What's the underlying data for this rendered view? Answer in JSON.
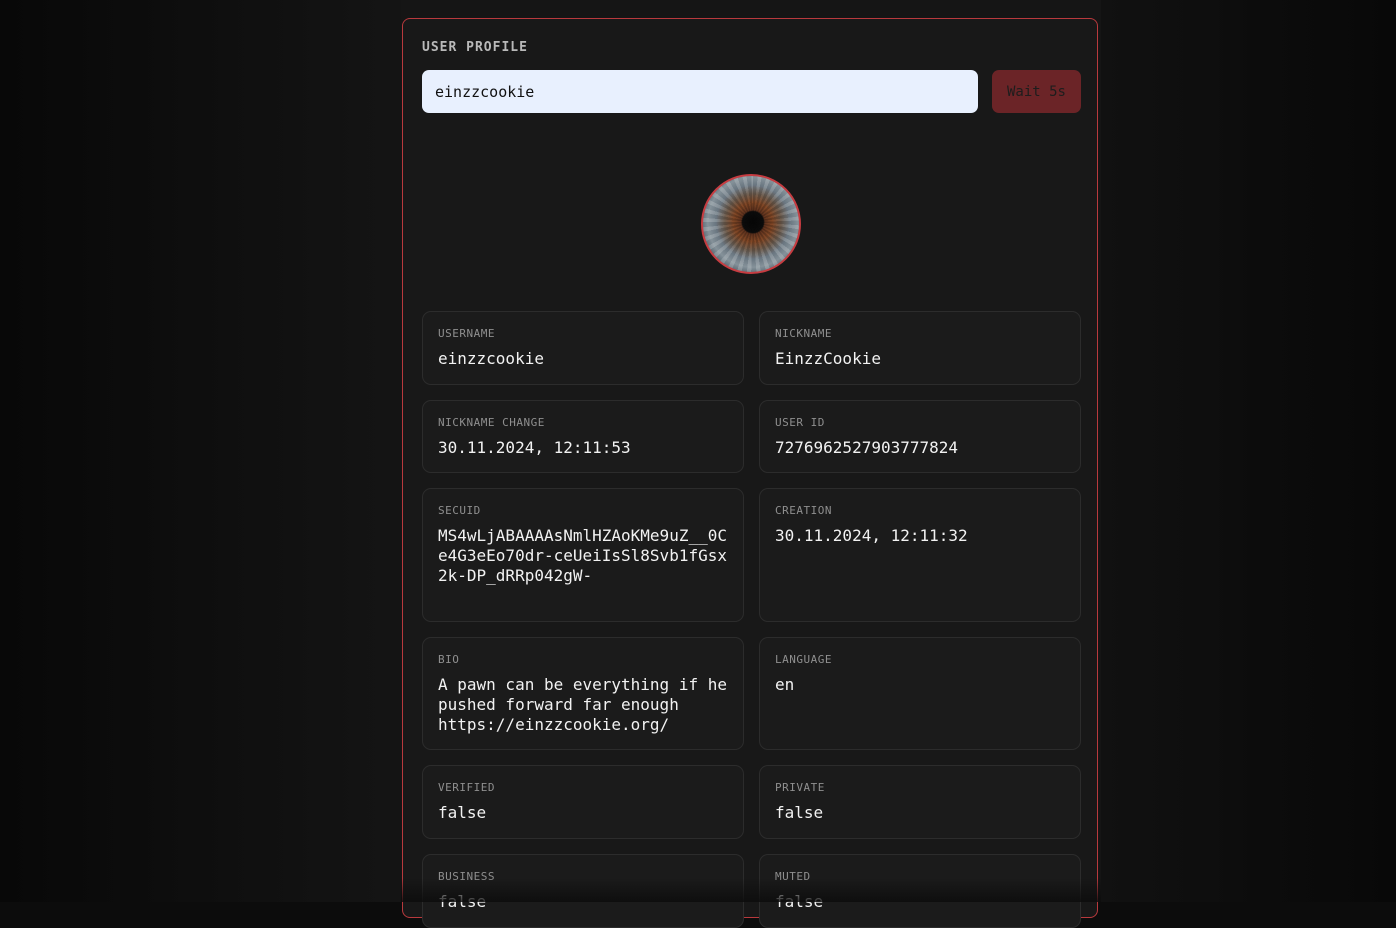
{
  "profile": {
    "section_title": "USER PROFILE",
    "search_value": "einzzcookie",
    "wait_label": "Wait 5s",
    "fields": {
      "username": {
        "label": "USERNAME",
        "value": "einzzcookie"
      },
      "nickname": {
        "label": "NICKNAME",
        "value": "EinzzCookie"
      },
      "nickname_change": {
        "label": "NICKNAME CHANGE",
        "value": "30.11.2024, 12:11:53"
      },
      "user_id": {
        "label": "USER ID",
        "value": "7276962527903777824"
      },
      "secuid": {
        "label": "SECUID",
        "value": "MS4wLjABAAAAsNmlHZAoKMe9uZ__0Ce4G3eEo70dr-ceUeiIsSl8Svb1fGsx2k-DP_dRRp042gW-"
      },
      "creation": {
        "label": "CREATION",
        "value": "30.11.2024, 12:11:32"
      },
      "bio": {
        "label": "BIO",
        "value": "A pawn can be everything if he pushed forward far enough https://einzzcookie.org/"
      },
      "language": {
        "label": "LANGUAGE",
        "value": "en"
      },
      "verified": {
        "label": "VERIFIED",
        "value": "false"
      },
      "private": {
        "label": "PRIVATE",
        "value": "false"
      },
      "business": {
        "label": "BUSINESS",
        "value": "false"
      },
      "muted": {
        "label": "MUTED",
        "value": "false"
      }
    }
  },
  "colors": {
    "accent": "#c63c41",
    "background": "#181818",
    "input_bg": "#e8f0fe",
    "button_bg": "#6b2427"
  }
}
